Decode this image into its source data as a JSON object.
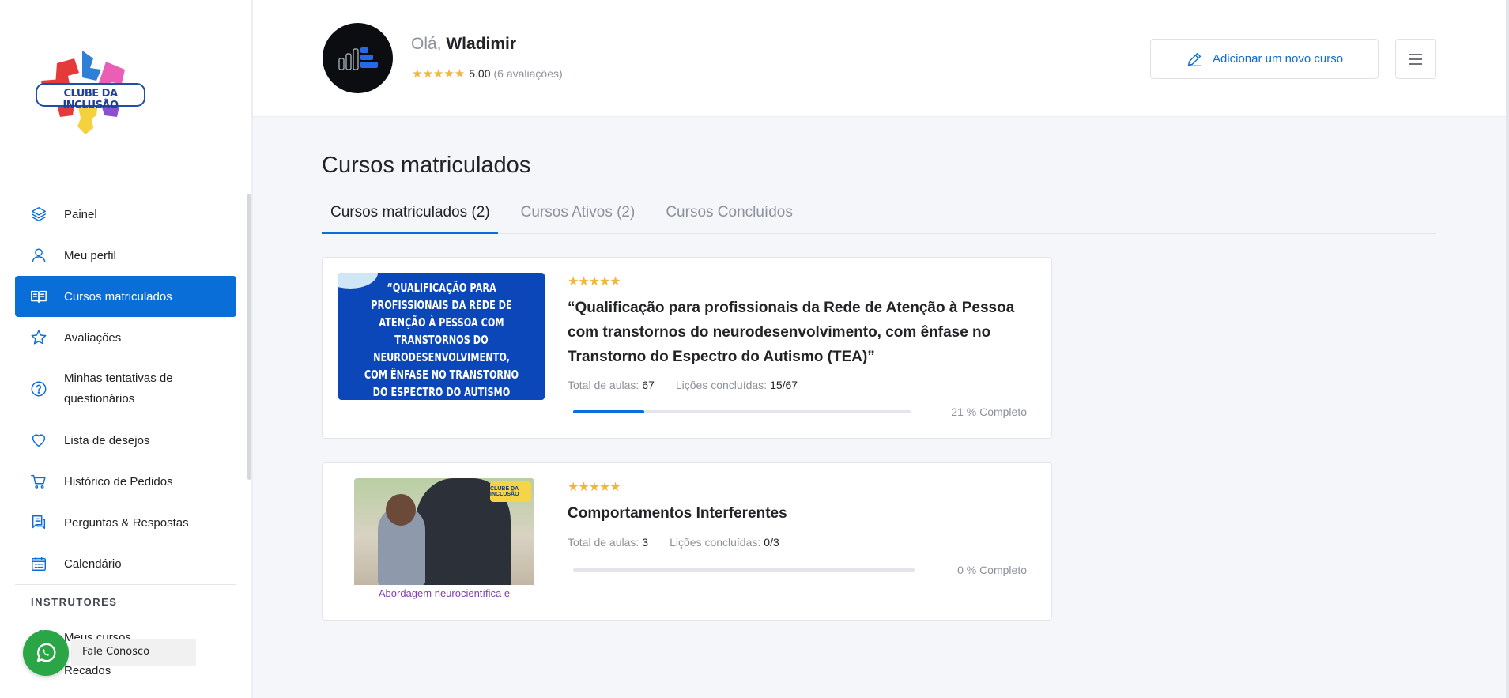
{
  "logo_text": "CLUBE DA INCLUSÃO",
  "sidebar": {
    "items": [
      {
        "label": "Painel",
        "icon": "layers-icon"
      },
      {
        "label": "Meu perfil",
        "icon": "user-icon"
      },
      {
        "label": "Cursos matriculados",
        "icon": "book-open-icon"
      },
      {
        "label": "Avaliações",
        "icon": "star-icon"
      },
      {
        "label": "Minhas tentativas de questionários",
        "icon": "question-circle-icon"
      },
      {
        "label": "Lista de desejos",
        "icon": "heart-icon"
      },
      {
        "label": "Histórico de Pedidos",
        "icon": "cart-icon"
      },
      {
        "label": "Perguntas & Respostas",
        "icon": "qa-icon"
      },
      {
        "label": "Calendário",
        "icon": "calendar-icon"
      }
    ],
    "section_heading": "INSTRUTORES",
    "instructor_items": [
      {
        "label": "Meus cursos"
      },
      {
        "label": "Recados"
      }
    ]
  },
  "whatsapp": {
    "label": "Fale Conosco"
  },
  "header": {
    "greeting": "Olá,",
    "user_name": "Wladimir",
    "stars": "★★★★★",
    "rating_value": "5.00",
    "rating_count": "(6 avaliações)",
    "add_course_label": "Adicionar um novo curso"
  },
  "main": {
    "title": "Cursos matriculados",
    "tabs": [
      {
        "label": "Cursos matriculados (2)",
        "active": true
      },
      {
        "label": "Cursos Ativos (2)",
        "active": false
      },
      {
        "label": "Cursos Concluídos",
        "active": false
      }
    ],
    "courses": [
      {
        "thumb_text": "“QUALIFICAÇÃO PARA PROFISSIONAIS DA REDE DE ATENÇÃO À PESSOA COM TRANSTORNOS DO NEURODESENVOLVIMENTO, COM ÊNFASE NO TRANSTORNO DO ESPECTRO DO AUTISMO (TEA)”",
        "stars": "★★★★★",
        "title": "“Qualificação para profissionais da Rede de Atenção à Pessoa com transtornos do neurodesenvolvimento, com ênfase no Transtorno do Espectro do Autismo (TEA)”",
        "total_label": "Total de aulas:",
        "total_value": "67",
        "done_label": "Lições concluídas:",
        "done_value": "15/67",
        "progress": 0.21,
        "percent_text": "21 % Completo"
      },
      {
        "thumb_caption": "Abordagem neurocientífica e",
        "thumb_logo": "CLUBE DA INCLUSÃO",
        "stars": "★★★★★",
        "title": "Comportamentos Interferentes",
        "total_label": "Total de aulas:",
        "total_value": "3",
        "done_label": "Lições concluídas:",
        "done_value": "0/3",
        "progress": 0,
        "percent_text": "0 % Completo"
      }
    ]
  },
  "colors": {
    "accent": "#0a6ed8",
    "star": "#f0b63e",
    "whatsapp": "#2aa647"
  }
}
